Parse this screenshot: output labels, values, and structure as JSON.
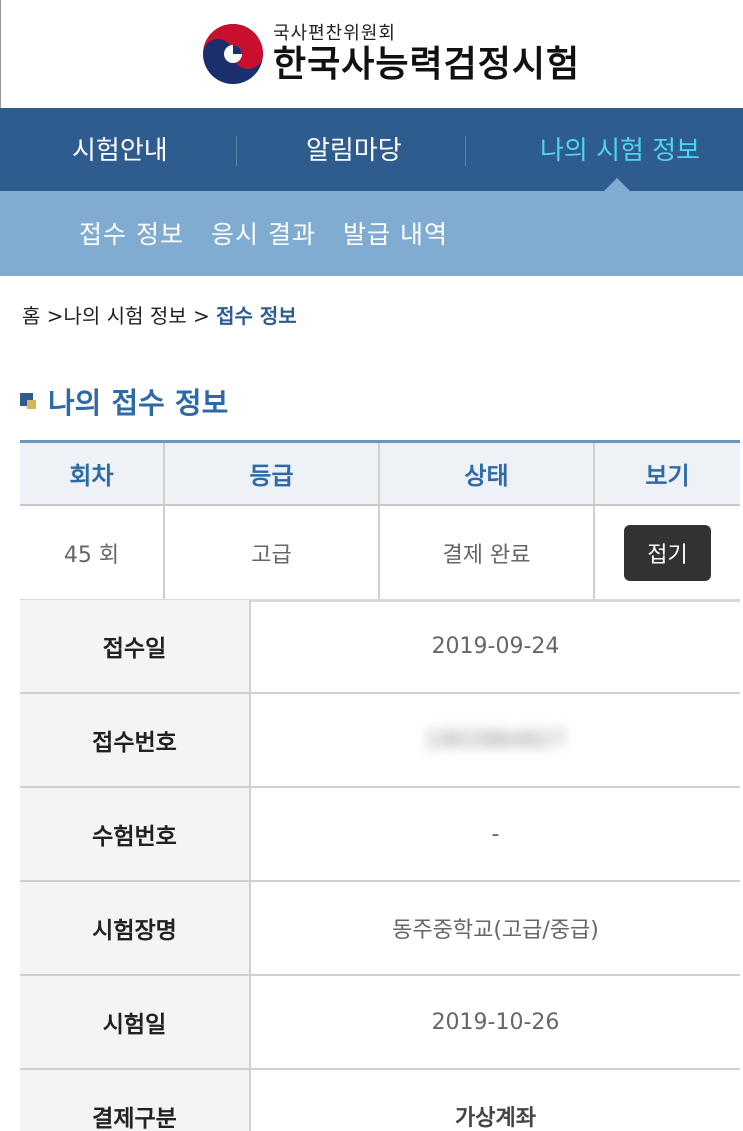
{
  "header": {
    "org_sub": "국사편찬위원회",
    "org_main": "한국사능력검정시험"
  },
  "main_nav": {
    "items": [
      "시험안내",
      "알림마당",
      "나의 시험 정보"
    ],
    "active_index": 2
  },
  "sub_nav": {
    "items": [
      "접수 정보",
      "응시 결과",
      "발급 내역"
    ]
  },
  "breadcrumb": {
    "prefix": "홈 >나의 시험 정보 > ",
    "current": "접수 정보"
  },
  "section": {
    "title": "나의 접수 정보"
  },
  "summary": {
    "headers": [
      "회차",
      "등급",
      "상태",
      "보기"
    ],
    "row": {
      "round": "45 회",
      "grade": "고급",
      "status": "결제 완료",
      "action": "접기"
    }
  },
  "details": [
    {
      "label": "접수일",
      "value": "2019-09-24"
    },
    {
      "label": "접수번호",
      "value": "1902884827"
    },
    {
      "label": "수험번호",
      "value": "-"
    },
    {
      "label": "시험장명",
      "value": "동주중학교(고급/중급)"
    },
    {
      "label": "시험일",
      "value": "2019-10-26"
    },
    {
      "label": "결제구분",
      "value": "가상계좌"
    }
  ],
  "colors": {
    "nav_bg": "#2f5c8f",
    "nav_active": "#4fd4f0",
    "sub_nav_bg": "#7facd0",
    "title_blue": "#2f6aa8",
    "button_bg": "#333333"
  }
}
